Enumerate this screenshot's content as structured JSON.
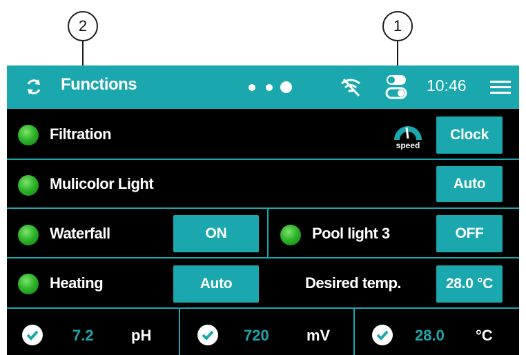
{
  "callouts": {
    "left": "2",
    "right": "1"
  },
  "topbar": {
    "title": "Functions",
    "time": "10:46"
  },
  "rows": {
    "filtration": {
      "label": "Filtration",
      "speed_label": "speed",
      "button": "Clock"
    },
    "multicolor": {
      "label": "Mulicolor Light",
      "button": "Auto"
    },
    "waterfall": {
      "label": "Waterfall",
      "button": "ON"
    },
    "pool_light": {
      "label": "Pool light 3",
      "button": "OFF"
    },
    "heating": {
      "label": "Heating",
      "button": "Auto"
    },
    "desired": {
      "label": "Desired temp.",
      "button": "28.0 °C"
    }
  },
  "measurements": [
    {
      "value": "7.2",
      "unit": "pH"
    },
    {
      "value": "720",
      "unit": "mV"
    },
    {
      "value": "28.0",
      "unit": "°C"
    }
  ],
  "colors": {
    "accent": "#1aa7ad",
    "background": "#000000",
    "led": "#2fb52a"
  },
  "icons": {
    "refresh": "refresh-icon",
    "wifi": "wifi-off-icon",
    "toggle": "toggle-icon",
    "menu": "hamburger-menu-icon"
  }
}
